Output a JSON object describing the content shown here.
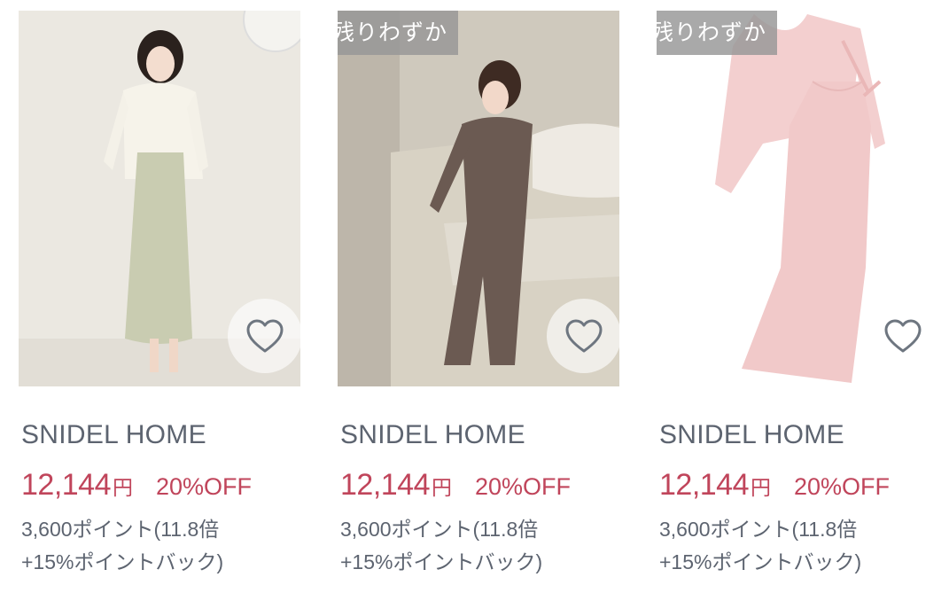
{
  "products": [
    {
      "badge": "",
      "brand": "SNIDEL HOME",
      "price": "12,144",
      "currency": "円",
      "discount": "20%OFF",
      "points_line1": "3,600ポイント(11.8倍",
      "points_line2": "+15%ポイントバック)",
      "favorite_icon": "heart-outline-icon",
      "colors": {
        "background": "#ebe8e1",
        "cardigan": "#f6f3ea",
        "dress": "#c9ccb1"
      }
    },
    {
      "badge": "残りわずか",
      "brand": "SNIDEL HOME",
      "price": "12,144",
      "currency": "円",
      "discount": "20%OFF",
      "points_line1": "3,600ポイント(11.8倍",
      "points_line2": "+15%ポイントバック)",
      "favorite_icon": "heart-outline-icon",
      "colors": {
        "background": "#cfc9bd",
        "bed": "#d8d2c4",
        "outfit": "#6b5a52"
      }
    },
    {
      "badge": "残りわずか",
      "brand": "SNIDEL HOME",
      "price": "12,144",
      "currency": "円",
      "discount": "20%OFF",
      "points_line1": "3,600ポイント(11.8倍",
      "points_line2": "+15%ポイントバック)",
      "favorite_icon": "heart-outline-icon",
      "colors": {
        "background": "#ffffff",
        "garment": "#f1c9c9"
      }
    }
  ],
  "colors": {
    "price": "#c0455b",
    "text": "#5d6470",
    "badge_bg": "#969696"
  }
}
